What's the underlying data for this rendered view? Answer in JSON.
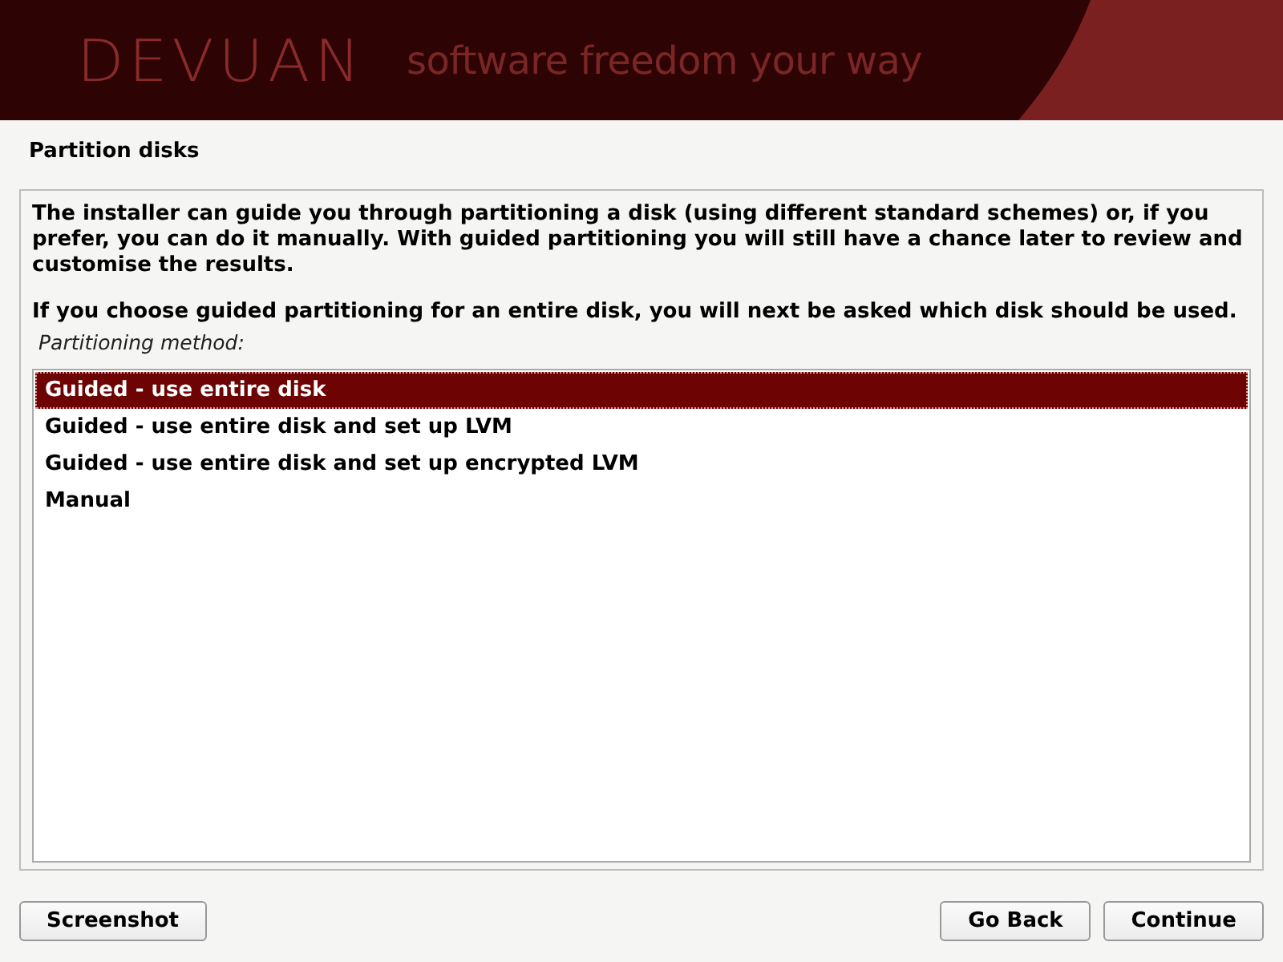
{
  "banner": {
    "logo": "DEVUAN",
    "tagline": "software freedom your way"
  },
  "title": "Partition disks",
  "paragraphs": [
    "The installer can guide you through partitioning a disk (using different standard schemes) or, if you prefer, you can do it manually. With guided partitioning you will still have a chance later to review and customise the results.",
    "If you choose guided partitioning for an entire disk, you will next be asked which disk should be used."
  ],
  "list_label": "Partitioning method:",
  "options": [
    {
      "label": "Guided - use entire disk",
      "selected": true
    },
    {
      "label": "Guided - use entire disk and set up LVM",
      "selected": false
    },
    {
      "label": "Guided - use entire disk and set up encrypted LVM",
      "selected": false
    },
    {
      "label": "Manual",
      "selected": false
    }
  ],
  "buttons": {
    "left": [
      "Screenshot"
    ],
    "right": [
      "Go Back",
      "Continue"
    ]
  }
}
